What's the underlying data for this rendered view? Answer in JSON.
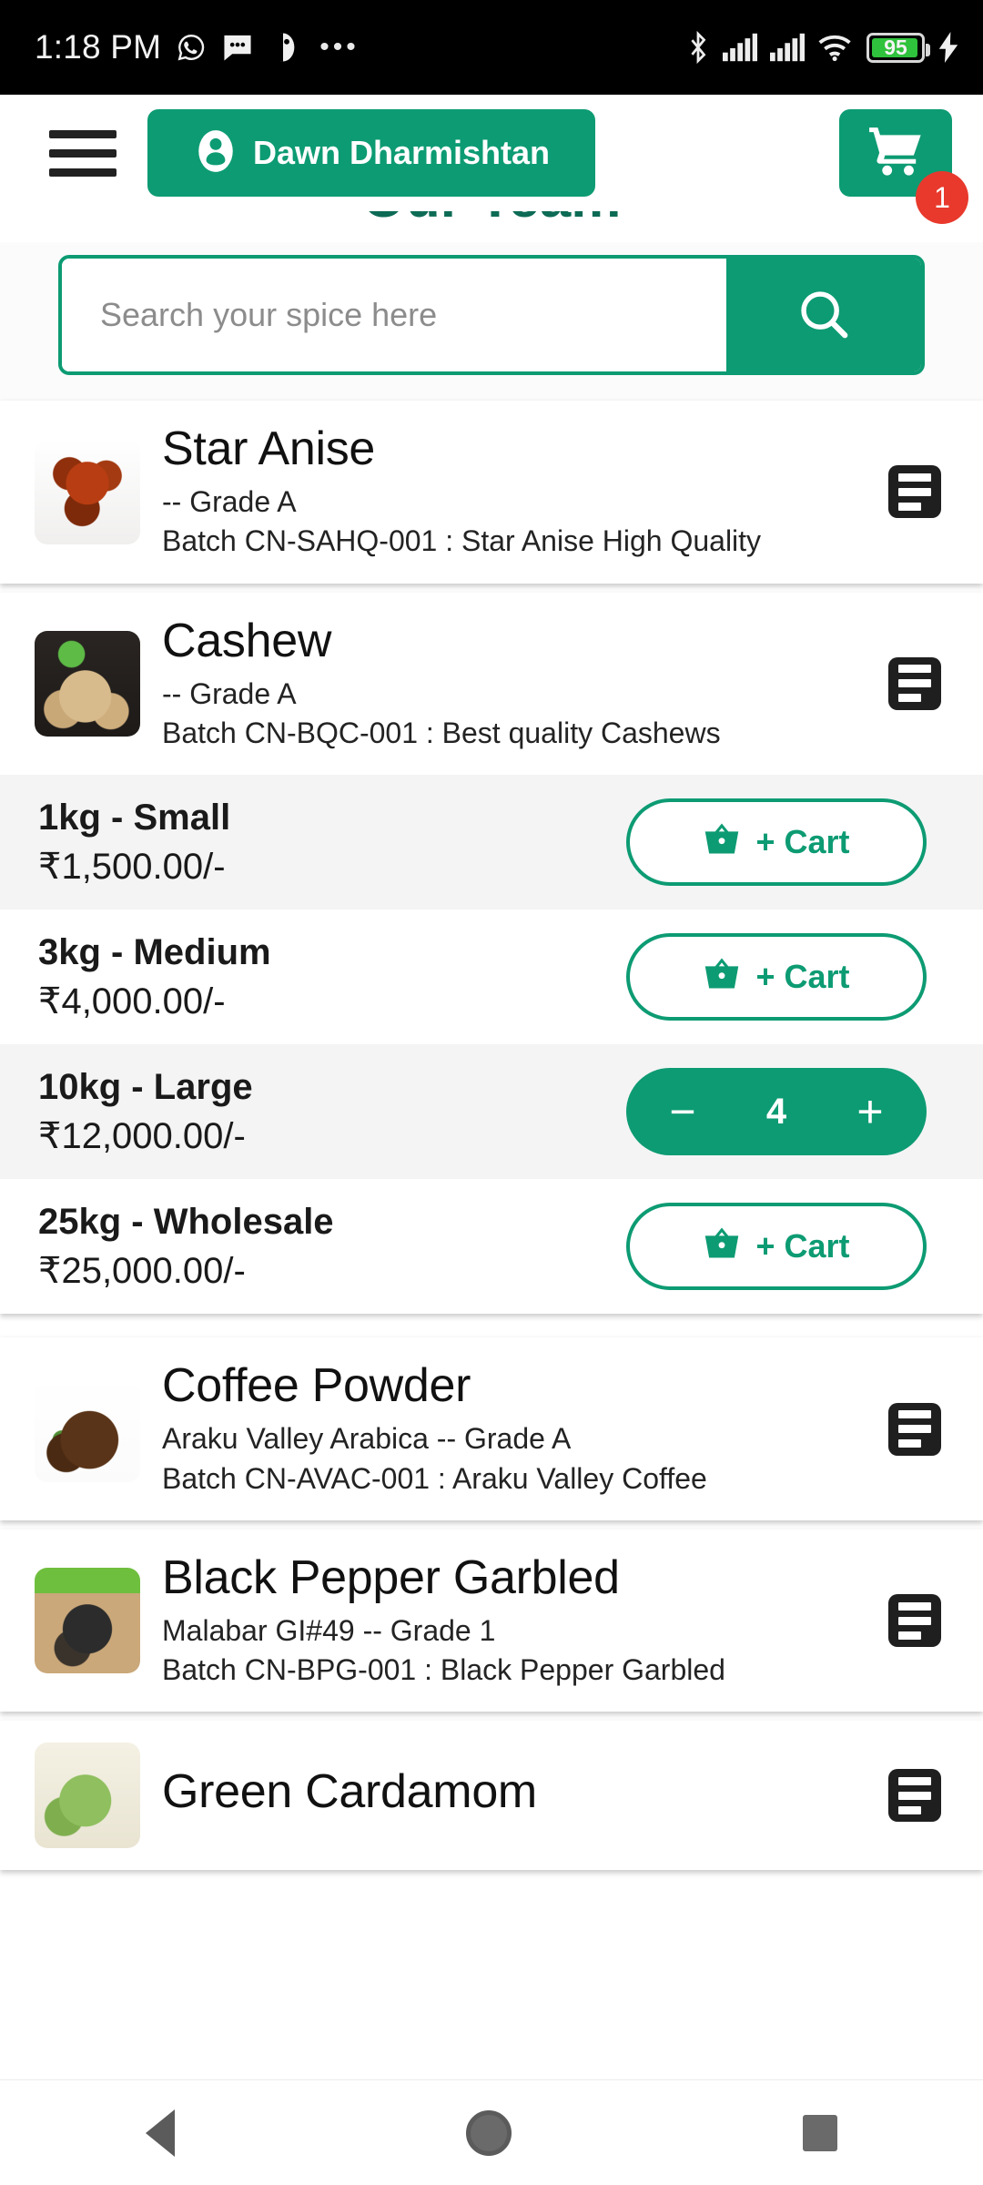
{
  "status_bar": {
    "time": "1:18 PM",
    "left_icons": [
      "whatsapp-icon",
      "message-icon",
      "notification-icon",
      "overflow-dots-icon"
    ],
    "right_icons": [
      "bluetooth-icon",
      "signal-sim1-icon",
      "signal-sim2-icon",
      "wifi-icon"
    ],
    "battery_percent": "95",
    "charging": true
  },
  "header": {
    "menu_icon": "hamburger-menu-icon",
    "account_icon": "person-icon",
    "account_name": "Dawn Dharmishtan",
    "cart_icon": "shopping-cart-icon",
    "cart_badge": "1"
  },
  "page": {
    "clipped_heading": "Our Team"
  },
  "search": {
    "placeholder": "Search your spice here",
    "value": "",
    "submit_icon": "search-icon"
  },
  "theme": {
    "green": "#0d9b73",
    "badge_red": "#e8392c",
    "dark": "#1f1f1f",
    "row_alt": "#f4f4f4"
  },
  "products": [
    {
      "name": "Star Anise",
      "subtitle": "-- Grade A",
      "batch": "Batch CN-SAHQ-001 : Star Anise High Quality",
      "thumb_class": "thumb-staranise",
      "details_icon": "list-details-icon",
      "expanded": false,
      "variants": []
    },
    {
      "name": "Cashew",
      "subtitle": "-- Grade A",
      "batch": "Batch CN-BQC-001 : Best quality Cashews",
      "thumb_class": "thumb-cashew",
      "details_icon": "list-details-icon",
      "expanded": true,
      "variants": [
        {
          "label": "1kg - Small",
          "price": "₹1,500.00/-",
          "mode": "add",
          "cart_label": "+ Cart",
          "cart_icon": "basket-icon",
          "qty": null,
          "alt_bg": true
        },
        {
          "label": "3kg - Medium",
          "price": "₹4,000.00/-",
          "mode": "add",
          "cart_label": "+ Cart",
          "cart_icon": "basket-icon",
          "qty": null,
          "alt_bg": false
        },
        {
          "label": "10kg - Large",
          "price": "₹12,000.00/-",
          "mode": "stepper",
          "cart_label": "+ Cart",
          "cart_icon": "basket-icon",
          "qty": "4",
          "alt_bg": true
        },
        {
          "label": "25kg - Wholesale",
          "price": "₹25,000.00/-",
          "mode": "add",
          "cart_label": "+ Cart",
          "cart_icon": "basket-icon",
          "qty": null,
          "alt_bg": false
        }
      ]
    },
    {
      "name": "Coffee Powder",
      "subtitle": "Araku Valley Arabica -- Grade A",
      "batch": "Batch CN-AVAC-001 : Araku Valley Coffee",
      "thumb_class": "thumb-coffee",
      "details_icon": "list-details-icon",
      "expanded": false,
      "variants": []
    },
    {
      "name": "Black Pepper Garbled",
      "subtitle": "Malabar GI#49 -- Grade 1",
      "batch": "Batch CN-BPG-001 : Black Pepper Garbled",
      "thumb_class": "thumb-pepper",
      "details_icon": "list-details-icon",
      "expanded": false,
      "variants": []
    },
    {
      "name": "Green Cardamom",
      "subtitle": "",
      "batch": "",
      "thumb_class": "thumb-cardamom",
      "details_icon": "list-details-icon",
      "expanded": false,
      "variants": []
    }
  ],
  "stepper_glyphs": {
    "minus": "−",
    "plus": "+"
  },
  "nav_bar": {
    "back": "back-triangle-icon",
    "home": "home-circle-icon",
    "recents": "recents-square-icon"
  }
}
